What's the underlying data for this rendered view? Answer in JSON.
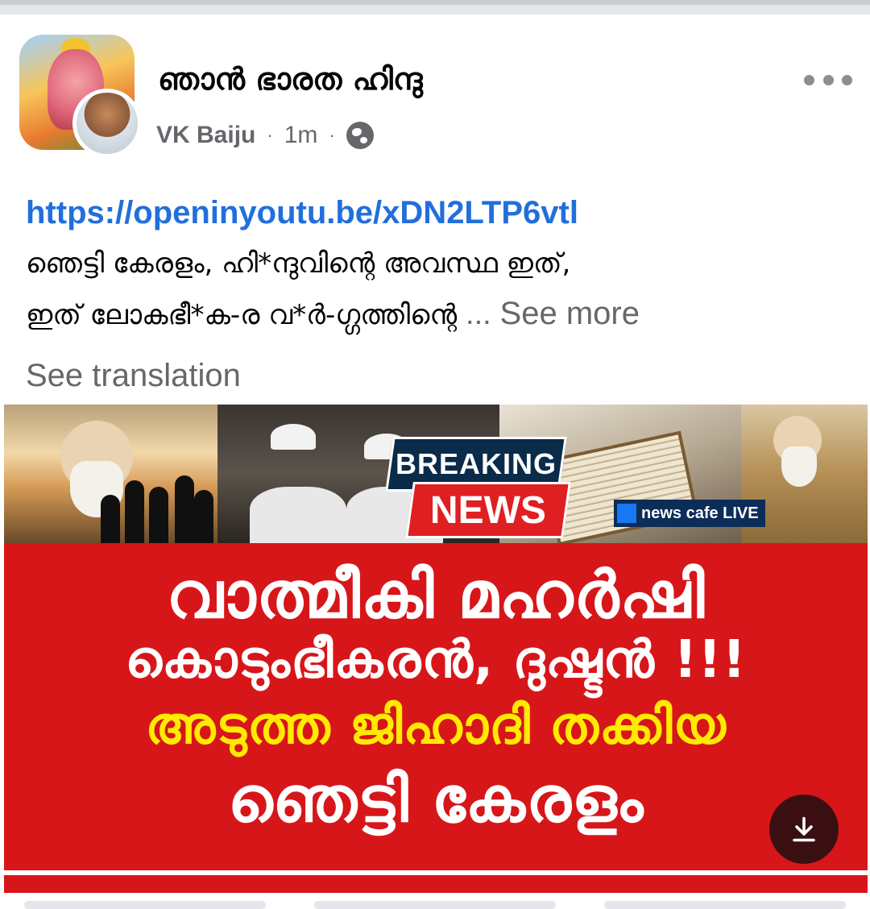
{
  "post": {
    "group_name": "ഞാൻ ഭാരത ഹിന്ദു",
    "author": "VK Baiju",
    "time": "1m",
    "separator": "·",
    "privacy_icon": "globe-icon",
    "more_icon": "more-options-icon",
    "link": "https://openinyoutu.be/xDN2LTP6vtl",
    "text_line_1": "ഞെട്ടി കേരളം, ഹി*ന്ദുവിന്റെ അവസ്ഥ ഇത്,",
    "text_line_2": "ഇത് ലോകഭീ*ക-ര വ*ർ-ഗ്ഗത്തിന്റെ",
    "ellipsis": "...",
    "see_more": "See more",
    "see_translation": "See translation"
  },
  "media": {
    "badge_top": "BREAKING",
    "badge_bottom": "NEWS",
    "channel_tag": "news cafe LIVE",
    "headline_1": "വാത്മീകി മഹർഷി",
    "headline_2": "കൊടുംഭീകരൻ, ദുഷ്ടൻ !!!",
    "headline_3": "അടുത്ത ജിഹാദി തക്കിയ",
    "headline_4": "ഞെട്ടി കേരളം",
    "download_icon": "download-icon"
  },
  "colors": {
    "link": "#216fdb",
    "secondary_text": "#65676b",
    "banner_red": "#d7161a",
    "headline_yellow": "#ffea00"
  }
}
